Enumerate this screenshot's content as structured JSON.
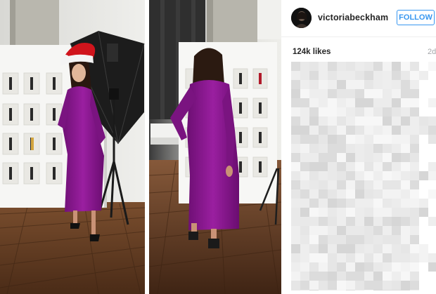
{
  "post": {
    "username": "victoriabeckham",
    "follow_label": "FOLLOW",
    "likes": "124k likes",
    "age": "2d",
    "caption_state": "pixelated"
  },
  "colors": {
    "follow_blue": "#3897f0",
    "dress_purple": "#8a1a8f",
    "text_dark": "#262626",
    "muted_gray": "#a5a7aa"
  },
  "icons": {
    "avatar": "profile-photo",
    "photo": "collage-two-frames"
  }
}
